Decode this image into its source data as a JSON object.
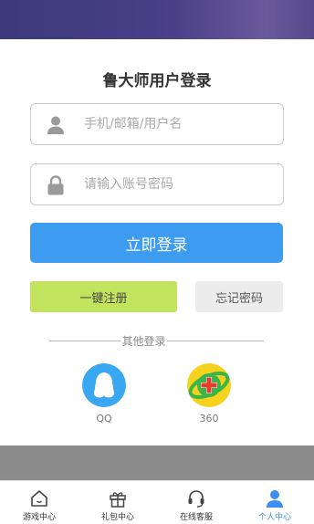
{
  "header": {
    "title": "鲁大师用户登录"
  },
  "form": {
    "username_placeholder": "手机/邮箱/用户名",
    "username_value": "",
    "password_placeholder": "请输入账号密码",
    "password_value": "",
    "login_label": "立即登录",
    "register_label": "一键注册",
    "forgot_label": "忘记密码"
  },
  "other_login": {
    "divider_label": "其他登录",
    "providers": [
      {
        "label": "QQ",
        "icon": "qq-icon",
        "color": "#3aa7f2"
      },
      {
        "label": "360",
        "icon": "360-icon",
        "color": "#f6d21c"
      }
    ]
  },
  "tabbar": {
    "items": [
      {
        "label": "游戏中心",
        "icon": "home-icon",
        "active": false
      },
      {
        "label": "礼包中心",
        "icon": "gift-icon",
        "active": false
      },
      {
        "label": "在线客服",
        "icon": "headset-icon",
        "active": false
      },
      {
        "label": "个人中心",
        "icon": "user-icon",
        "active": true
      }
    ]
  },
  "colors": {
    "primary": "#3d9cf0",
    "register": "#c2e35d",
    "header_gradient": "#3b3a7c",
    "tab_active": "#3d8ef0"
  }
}
